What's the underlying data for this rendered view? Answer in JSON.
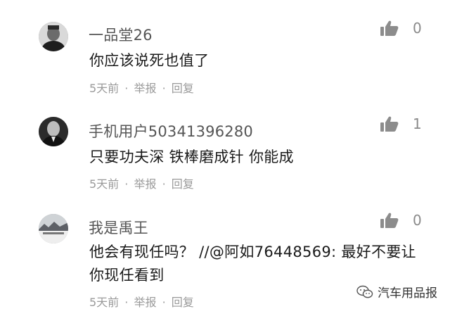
{
  "comments": [
    {
      "username": "一品堂26",
      "content": "你应该说死也值了",
      "time": "5天前",
      "separator": "·",
      "report": "举报",
      "reply": "回复",
      "likes": "0",
      "avatar_icon": "avatar-man-dark-icon"
    },
    {
      "username": "手机用户50341396280",
      "content": "只要功夫深 铁棒磨成针 你能成",
      "time": "5天前",
      "separator": "·",
      "report": "举报",
      "reply": "回复",
      "likes": "1",
      "avatar_icon": "avatar-godfather-icon"
    },
    {
      "username": "我是禹王",
      "content": "他会有现任吗？ //@阿如76448569: 最好不要让你现任看到",
      "time": "5天前",
      "separator": "·",
      "report": "举报",
      "reply": "回复",
      "likes": "0",
      "avatar_icon": "avatar-landscape-icon"
    }
  ],
  "watermark": {
    "text": "汽车用品报",
    "icon": "wechat-icon"
  },
  "colors": {
    "username": "#555555",
    "meta": "#9a9a9a",
    "like_icon": "#8c8c8c"
  }
}
